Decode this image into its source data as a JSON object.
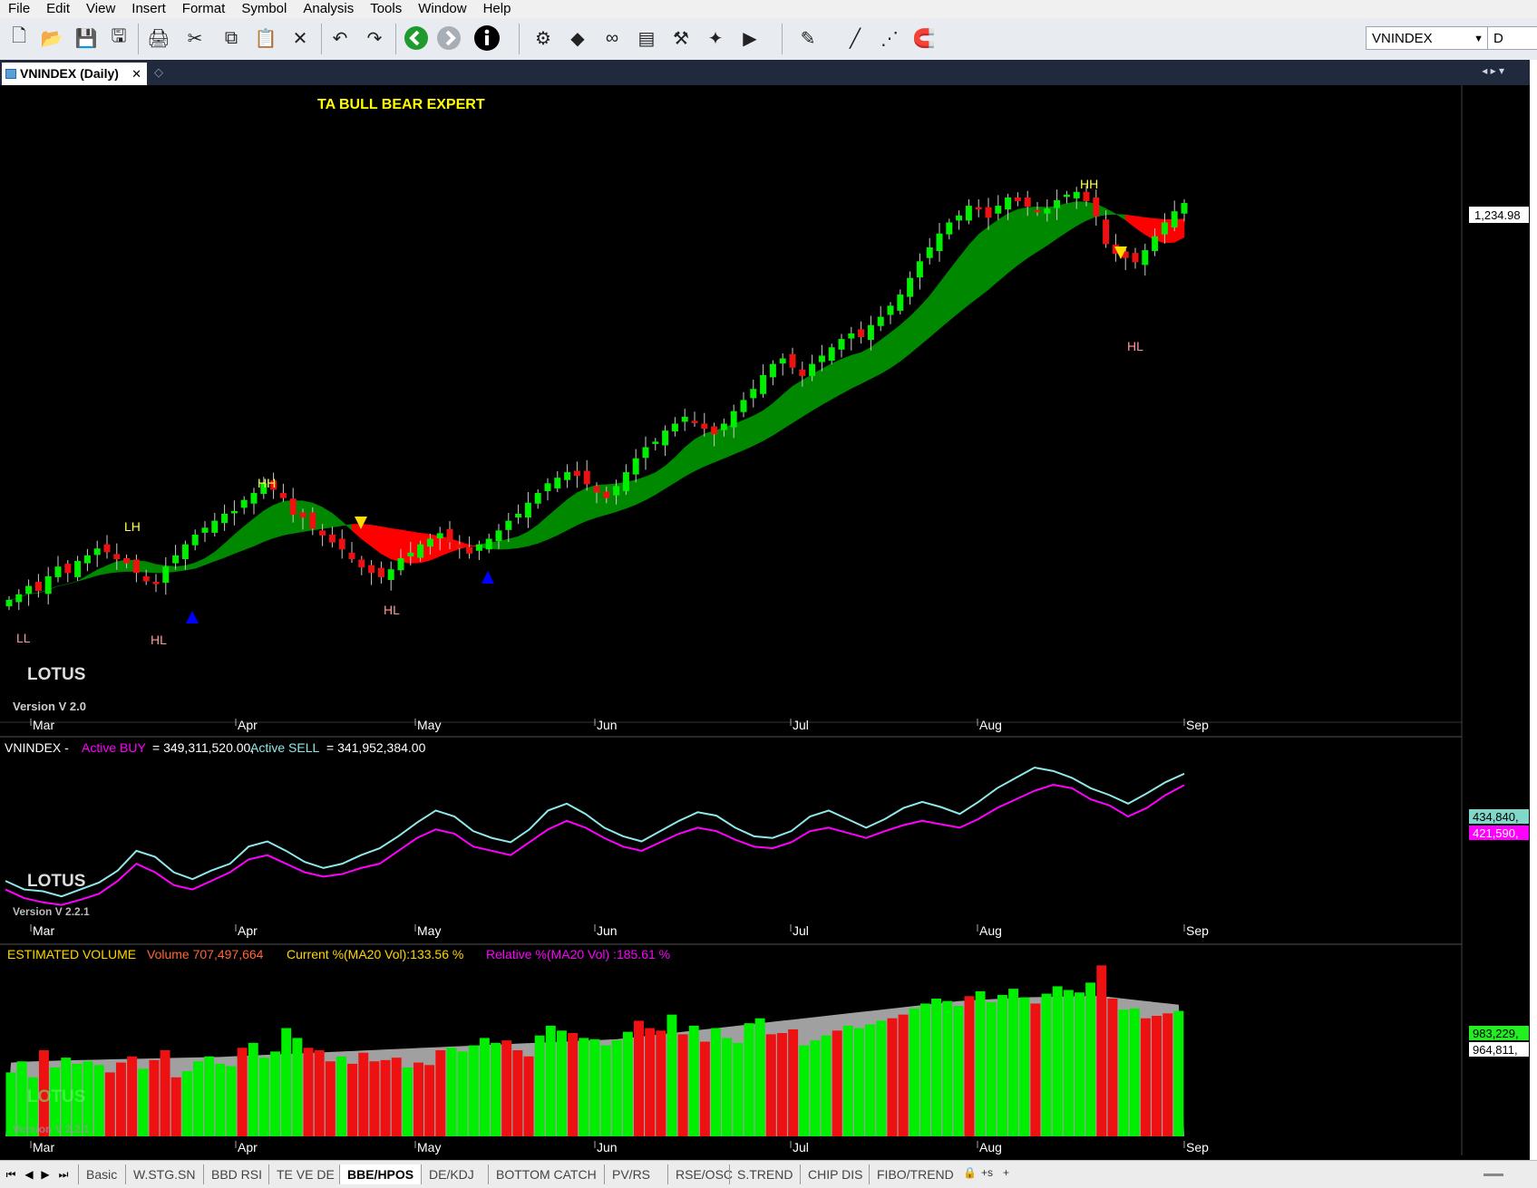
{
  "menu": [
    "File",
    "Edit",
    "View",
    "Insert",
    "Format",
    "Symbol",
    "Analysis",
    "Tools",
    "Window",
    "Help"
  ],
  "toolbar": {
    "symbol": "VNINDEX",
    "interval": "D",
    "icons": [
      "new-file-icon",
      "open-folder-icon",
      "save-icon",
      "save-all-icon",
      "print-icon",
      "cut-icon",
      "copy-icon",
      "paste-icon",
      "delete-icon",
      "undo-icon",
      "redo-icon",
      "back-icon",
      "forward-icon",
      "info-icon",
      "settings-icon",
      "indicator-icon",
      "binoculars-icon",
      "document-icon",
      "hammer-icon",
      "wand-icon",
      "chart-play-icon",
      "highlighter-icon",
      "line-tool-icon",
      "dotted-line-icon",
      "magnet-icon"
    ]
  },
  "document_tab": {
    "label": "VNINDEX (Daily)",
    "close": "✕"
  },
  "chart": {
    "title": "TA BULL BEAR EXPERT",
    "brand": "LOTUS",
    "version_main": "Version V 2.0",
    "version_sub": "Version V 2.2.1",
    "last_price": "1,234.98",
    "months": [
      "Mar",
      "Apr",
      "May",
      "Jun",
      "Jul",
      "Aug",
      "Sep"
    ],
    "swing_labels": [
      "LL",
      "LH",
      "HL",
      "HH",
      "HL",
      "HH",
      "HL"
    ],
    "colors": {
      "bull": "#00ee00",
      "bear": "#ee1111",
      "cloud_bull": "#008800",
      "cloud_bear": "#ff0000",
      "title": "#ffff00",
      "grid_text": "#ffffff",
      "buy": "#ff00ff",
      "sell": "#8fe8e8",
      "marker_up": "#0000ff",
      "marker_down": "#ffdd00"
    }
  },
  "chart_data": [
    {
      "type": "candlestick",
      "title": "TA BULL BEAR EXPERT",
      "x_ticks": [
        "Mar",
        "Apr",
        "May",
        "Jun",
        "Jul",
        "Aug",
        "Sep"
      ],
      "close": [
        1148,
        1152,
        1158,
        1155,
        1165,
        1172,
        1168,
        1176,
        1180,
        1185,
        1183,
        1178,
        1175,
        1168,
        1162,
        1160,
        1172,
        1180,
        1188,
        1195,
        1200,
        1205,
        1210,
        1212,
        1220,
        1225,
        1232,
        1228,
        1222,
        1210,
        1208,
        1200,
        1195,
        1190,
        1185,
        1178,
        1172,
        1168,
        1165,
        1170,
        1178,
        1182,
        1188,
        1192,
        1196,
        1190,
        1186,
        1182,
        1188,
        1192,
        1198,
        1205,
        1210,
        1218,
        1225,
        1232,
        1236,
        1240,
        1238,
        1232,
        1226,
        1222,
        1230,
        1240,
        1250,
        1258,
        1262,
        1270,
        1275,
        1280,
        1276,
        1272,
        1268,
        1275,
        1284,
        1292,
        1300,
        1310,
        1318,
        1322,
        1316,
        1310,
        1318,
        1324,
        1330,
        1336,
        1340,
        1338,
        1346,
        1352,
        1360,
        1368,
        1380,
        1392,
        1402,
        1412,
        1420,
        1425,
        1432,
        1430,
        1424,
        1432,
        1438,
        1436,
        1432,
        1428,
        1430,
        1436,
        1440,
        1442,
        1436,
        1425,
        1405,
        1398,
        1395,
        1392,
        1400,
        1410,
        1420,
        1428,
        1434,
        1234.98
      ],
      "last_close": 1234.98,
      "swing_labels": [
        {
          "label": "LL"
        },
        {
          "label": "LH"
        },
        {
          "label": "HL"
        },
        {
          "label": "HH"
        },
        {
          "label": "HL"
        },
        {
          "label": "HH"
        },
        {
          "label": "HL"
        }
      ]
    },
    {
      "type": "line",
      "title": "VNINDEX - Active BUY = 349,311,520.00, Active SELL = 341,952,384.00",
      "header": {
        "symbol": "VNINDEX -",
        "buy_label": "Active BUY",
        "buy_value": "= 349,311,520.00,",
        "sell_label": "Active SELL",
        "sell_value": "= 341,952,384.00"
      },
      "x_ticks": [
        "Mar",
        "Apr",
        "May",
        "Jun",
        "Jul",
        "Aug",
        "Sep"
      ],
      "series": [
        {
          "name": "Active BUY",
          "values": [
            300,
            290,
            285,
            282,
            288,
            295,
            310,
            330,
            320,
            305,
            300,
            310,
            320,
            335,
            340,
            330,
            320,
            315,
            318,
            325,
            330,
            345,
            360,
            370,
            365,
            350,
            345,
            340,
            355,
            370,
            380,
            372,
            360,
            350,
            345,
            355,
            365,
            372,
            368,
            358,
            350,
            348,
            355,
            368,
            372,
            366,
            360,
            368,
            375,
            380,
            376,
            372,
            382,
            395,
            405,
            415,
            422,
            418,
            405,
            398,
            385,
            395,
            410,
            421.59
          ]
        },
        {
          "name": "Active SELL",
          "values": [
            310,
            300,
            298,
            292,
            300,
            308,
            322,
            345,
            338,
            320,
            312,
            322,
            330,
            350,
            356,
            345,
            332,
            325,
            330,
            340,
            348,
            362,
            378,
            392,
            385,
            368,
            360,
            355,
            370,
            392,
            400,
            388,
            372,
            362,
            356,
            368,
            380,
            390,
            386,
            372,
            362,
            360,
            368,
            385,
            392,
            382,
            372,
            382,
            395,
            402,
            396,
            388,
            402,
            418,
            430,
            442,
            438,
            430,
            418,
            410,
            400,
            412,
            425,
            434.84
          ]
        }
      ],
      "axis_labels": [
        "434,840,",
        "421,590,"
      ]
    },
    {
      "type": "bar",
      "title": "ESTIMATED VOLUME",
      "header": {
        "label": "ESTIMATED VOLUME",
        "volume": "Volume 707,497,664",
        "current": "Current %(MA20 Vol):133.56 %",
        "relative": "Relative %(MA20 Vol) :185.61 %"
      },
      "x_ticks": [
        "Mar",
        "Apr",
        "May",
        "Jun",
        "Jul",
        "Aug",
        "Sep"
      ],
      "volume_millions": [
        520,
        610,
        480,
        700,
        560,
        640,
        590,
        610,
        580,
        520,
        600,
        650,
        550,
        620,
        700,
        480,
        530,
        610,
        650,
        590,
        570,
        720,
        760,
        640,
        690,
        880,
        800,
        720,
        700,
        610,
        650,
        590,
        680,
        610,
        620,
        640,
        560,
        600,
        580,
        700,
        720,
        690,
        740,
        800,
        760,
        780,
        700,
        650,
        820,
        900,
        860,
        840,
        800,
        790,
        740,
        780,
        850,
        940,
        880,
        860,
        990,
        830,
        900,
        770,
        880,
        800,
        760,
        920,
        960,
        830,
        840,
        870,
        740,
        780,
        820,
        860,
        900,
        880,
        910,
        940,
        960,
        990,
        1040,
        1080,
        1120,
        1100,
        1060,
        1140,
        1180,
        1090,
        1150,
        1200,
        1130,
        1080,
        1160,
        1220,
        1190,
        1170,
        1250,
        1390,
        1120,
        1030,
        1040,
        960,
        980,
        1000,
        1020
      ],
      "ma20_millions": [
        600,
        605,
        610,
        612,
        615,
        618,
        620,
        622,
        624,
        626,
        628,
        630,
        632,
        634,
        636,
        638,
        640,
        642,
        644,
        646,
        650,
        654,
        658,
        662,
        666,
        670,
        674,
        678,
        682,
        686,
        690,
        694,
        698,
        702,
        706,
        710,
        714,
        718,
        722,
        726,
        730,
        734,
        738,
        742,
        746,
        750,
        754,
        758,
        762,
        766,
        770,
        774,
        778,
        782,
        786,
        790,
        800,
        810,
        820,
        830,
        840,
        850,
        860,
        870,
        880,
        890,
        900,
        910,
        920,
        930,
        940,
        950,
        960,
        970,
        980,
        990,
        1000,
        1010,
        1020,
        1030,
        1040,
        1050,
        1060,
        1070,
        1080,
        1090,
        1100,
        1105,
        1110,
        1115,
        1120,
        1125,
        1130,
        1132,
        1134,
        1136,
        1138,
        1140,
        1142,
        1140,
        1130,
        1120,
        1110,
        1100,
        1090,
        1080,
        1070
      ],
      "axis_labels": [
        "983,229,",
        "964,811,"
      ]
    }
  ],
  "sheet_tabs": [
    "Basic",
    "W.STG.SN",
    "BBD RSI",
    "TE VE DE",
    "BBE/HPOS",
    "DE/KDJ",
    "BOTTOM CATCH",
    "PV/RS",
    "RSE/OSC",
    "S.TREND",
    "CHIP DIS",
    "FIBO/TREND"
  ],
  "active_sheet": "BBE/HPOS"
}
